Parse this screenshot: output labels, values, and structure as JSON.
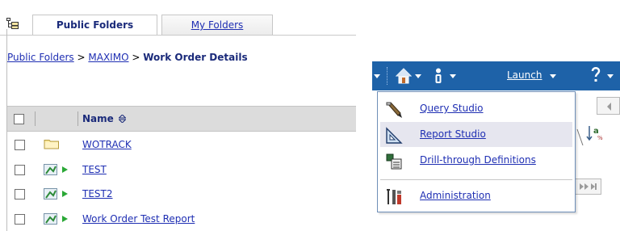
{
  "left_panel": {
    "tabs": [
      {
        "label": "Public Folders",
        "active": true
      },
      {
        "label": "My Folders",
        "active": false
      }
    ],
    "breadcrumb": {
      "links": [
        "Public Folders",
        "MAXIMO"
      ],
      "separator": ">",
      "current": "Work Order Details"
    },
    "table": {
      "column_name": "Name",
      "sort_icon": "sort-updown-icon",
      "rows": [
        {
          "name": "WOTRACK",
          "icon": "folder-icon"
        },
        {
          "name": "TEST",
          "icon": "report-run-icon"
        },
        {
          "name": "TEST2",
          "icon": "report-run-icon"
        },
        {
          "name": "Work Order Test Report",
          "icon": "report-run-icon"
        }
      ]
    }
  },
  "right_panel": {
    "toolbar": {
      "launch_label": "Launch",
      "icons": [
        "home-icon",
        "user-icon",
        "help-icon"
      ]
    },
    "launch_menu": {
      "items": [
        {
          "label": "Query Studio",
          "icon": "query-studio-icon"
        },
        {
          "label": "Report Studio",
          "icon": "report-studio-icon",
          "highlighted": true
        },
        {
          "label": "Drill-through Definitions",
          "icon": "drill-through-icon"
        },
        {
          "label": "Administration",
          "icon": "administration-icon"
        }
      ]
    }
  },
  "colors": {
    "toolbar_bg": "#1e62a8",
    "link": "#1f2fb3",
    "header_bg": "#dcdcdc",
    "menu_highlight": "#e6e6ef"
  }
}
